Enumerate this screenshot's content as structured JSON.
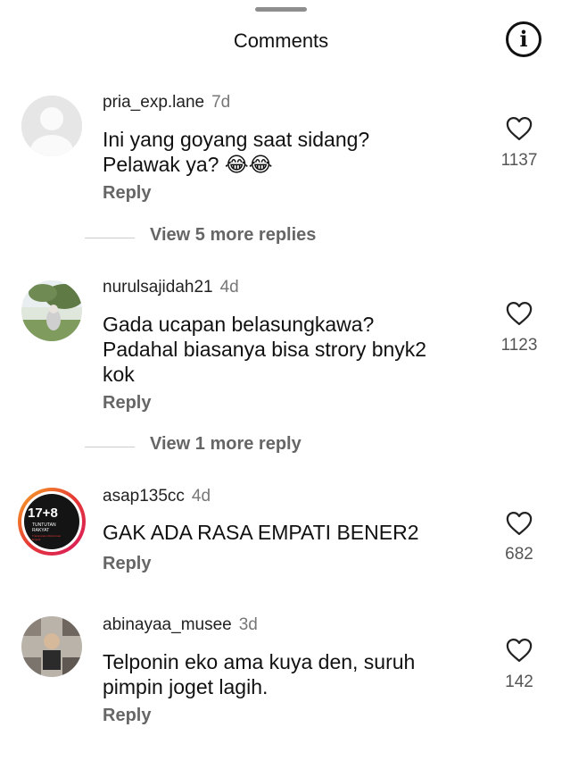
{
  "header": {
    "title": "Comments",
    "info_icon": "info-icon"
  },
  "comments": [
    {
      "username": "pria_exp.lane",
      "age": "7d",
      "text_lines": [
        "Ini yang goyang saat sidang?",
        "Pelawak ya? 😂😂"
      ],
      "reply_label": "Reply",
      "likes": "1137",
      "view_more": "View 5 more replies"
    },
    {
      "username": "nurulsajidah21",
      "age": "4d",
      "text_lines": [
        "Gada ucapan belasungkawa?",
        "Padahal biasanya bisa strory bnyk2",
        "kok"
      ],
      "reply_label": "Reply",
      "likes": "1123",
      "view_more": "View 1 more reply"
    },
    {
      "username": "asap135cc",
      "age": "4d",
      "avatar_text": {
        "big": "17+8",
        "mid": "TUNTUTAN RAKYAT",
        "small": "Transparansi Reformasi Empati"
      },
      "text_lines": [
        "GAK ADA RASA EMPATI BENER2"
      ],
      "reply_label": "Reply",
      "likes": "682"
    },
    {
      "username": "abinayaa_musee",
      "age": "3d",
      "text_lines": [
        "Telponin eko ama kuya den, suruh",
        "pimpin joget lagih."
      ],
      "reply_label": "Reply",
      "likes": "142"
    }
  ],
  "colors": {
    "text": "#111111",
    "muted": "#666666",
    "heart_outline": "#222222",
    "story_ring_start": "#f9a825",
    "story_ring_end": "#d81b60"
  }
}
